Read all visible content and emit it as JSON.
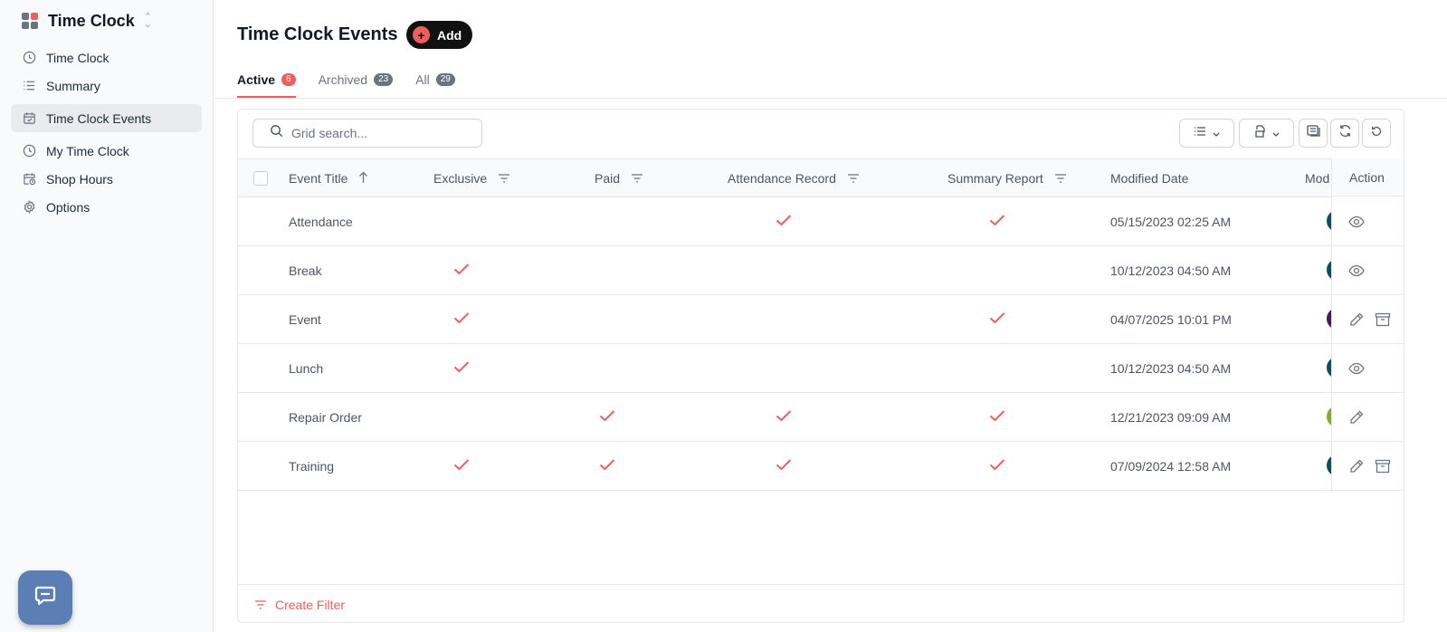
{
  "app": {
    "title": "Time Clock"
  },
  "sidebar": {
    "items": [
      {
        "label": "Time Clock",
        "icon": "clock-icon"
      },
      {
        "label": "Summary",
        "icon": "list-icon"
      },
      {
        "label": "Time Clock Events",
        "icon": "calendar-check-icon",
        "active": true
      },
      {
        "label": "My Time Clock",
        "icon": "clock-icon"
      },
      {
        "label": "Shop Hours",
        "icon": "calendar-clock-icon"
      },
      {
        "label": "Options",
        "icon": "gear-icon"
      }
    ]
  },
  "header": {
    "title": "Time Clock Events",
    "add_label": "Add"
  },
  "tabs": [
    {
      "label": "Active",
      "count": "6"
    },
    {
      "label": "Archived",
      "count": "23"
    },
    {
      "label": "All",
      "count": "29"
    }
  ],
  "search": {
    "placeholder": "Grid search..."
  },
  "columns": {
    "event_title": "Event Title",
    "exclusive": "Exclusive",
    "paid": "Paid",
    "attendance_record": "Attendance Record",
    "summary_report": "Summary Report",
    "modified_date": "Modified Date",
    "modified_by": "Mod",
    "action": "Action"
  },
  "rows": [
    {
      "title": "Attendance",
      "exclusive": false,
      "paid": false,
      "attendance": true,
      "summary": true,
      "date": "05/15/2023 02:25 AM",
      "avatar_color": "#0e4f5c",
      "actions": [
        "view"
      ]
    },
    {
      "title": "Break",
      "exclusive": true,
      "paid": false,
      "attendance": false,
      "summary": false,
      "date": "10/12/2023 04:50 AM",
      "avatar_color": "#0e4f5c",
      "actions": [
        "view"
      ]
    },
    {
      "title": "Event",
      "exclusive": true,
      "paid": false,
      "attendance": false,
      "summary": true,
      "date": "04/07/2025 10:01 PM",
      "avatar_color": "#4a1a5c",
      "actions": [
        "edit",
        "archive"
      ]
    },
    {
      "title": "Lunch",
      "exclusive": true,
      "paid": false,
      "attendance": false,
      "summary": false,
      "date": "10/12/2023 04:50 AM",
      "avatar_color": "#0e4f5c",
      "actions": [
        "view"
      ]
    },
    {
      "title": "Repair Order",
      "exclusive": false,
      "paid": true,
      "attendance": true,
      "summary": true,
      "date": "12/21/2023 09:09 AM",
      "avatar_color": "#7fb02a",
      "actions": [
        "edit"
      ]
    },
    {
      "title": "Training",
      "exclusive": true,
      "paid": true,
      "attendance": true,
      "summary": true,
      "date": "07/09/2024 12:58 AM",
      "avatar_color": "#0e4f5c",
      "actions": [
        "edit",
        "archive"
      ]
    }
  ],
  "footer": {
    "create_filter_label": "Create Filter"
  },
  "colors": {
    "accent": "#ef5e5e",
    "check": "#ef5e5e",
    "chat": "#5a7fb5"
  }
}
